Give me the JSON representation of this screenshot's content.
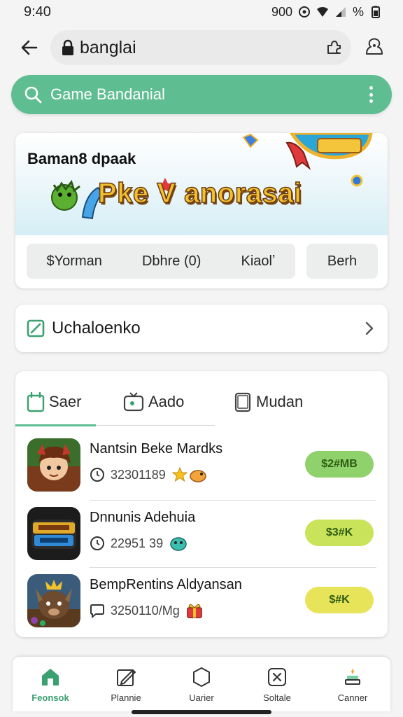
{
  "status_bar": {
    "time": "9:40",
    "battery_text": "900",
    "percent_symbol": "%"
  },
  "url_bar": {
    "url": "banglai"
  },
  "search": {
    "placeholder": "Game Bandanial"
  },
  "banner": {
    "subtitle": "Baman8 dpaak",
    "title": "Pke V anorasai",
    "chips": [
      "$Yorman",
      "Dbhre (0)",
      "Kiaolʼ"
    ],
    "chip_single": "Berh"
  },
  "category": {
    "label": "Uchaloenko"
  },
  "tabs": [
    {
      "label": "Saer",
      "icon": "calendar-icon"
    },
    {
      "label": "Aado",
      "icon": "tv-icon"
    },
    {
      "label": "Mudan",
      "icon": "device-icon"
    }
  ],
  "apps": [
    {
      "name": "Nantsin Beke Mardks",
      "meta": "32301189",
      "button": "$2#MB",
      "button_color": "#8fd16a"
    },
    {
      "name": "Dnnunis Adehuia",
      "meta": "22951 39",
      "button": "$3#K",
      "button_color": "#c9e35a"
    },
    {
      "name": "BempRentins Aldyansan",
      "meta": "3250110/Mg",
      "button": "$#K",
      "button_color": "#e7e45a"
    }
  ],
  "bottom_nav": [
    {
      "label": "Feonsok",
      "icon": "home-icon",
      "active": true
    },
    {
      "label": "Plannie",
      "icon": "edit-icon",
      "active": false
    },
    {
      "label": "Uarier",
      "icon": "hexagon-icon",
      "active": false
    },
    {
      "label": "Soltale",
      "icon": "close-box-icon",
      "active": false
    },
    {
      "label": "Canner",
      "icon": "stack-icon",
      "active": false
    }
  ],
  "colors": {
    "accent": "#5fbd92",
    "background": "#f3f4f3"
  }
}
